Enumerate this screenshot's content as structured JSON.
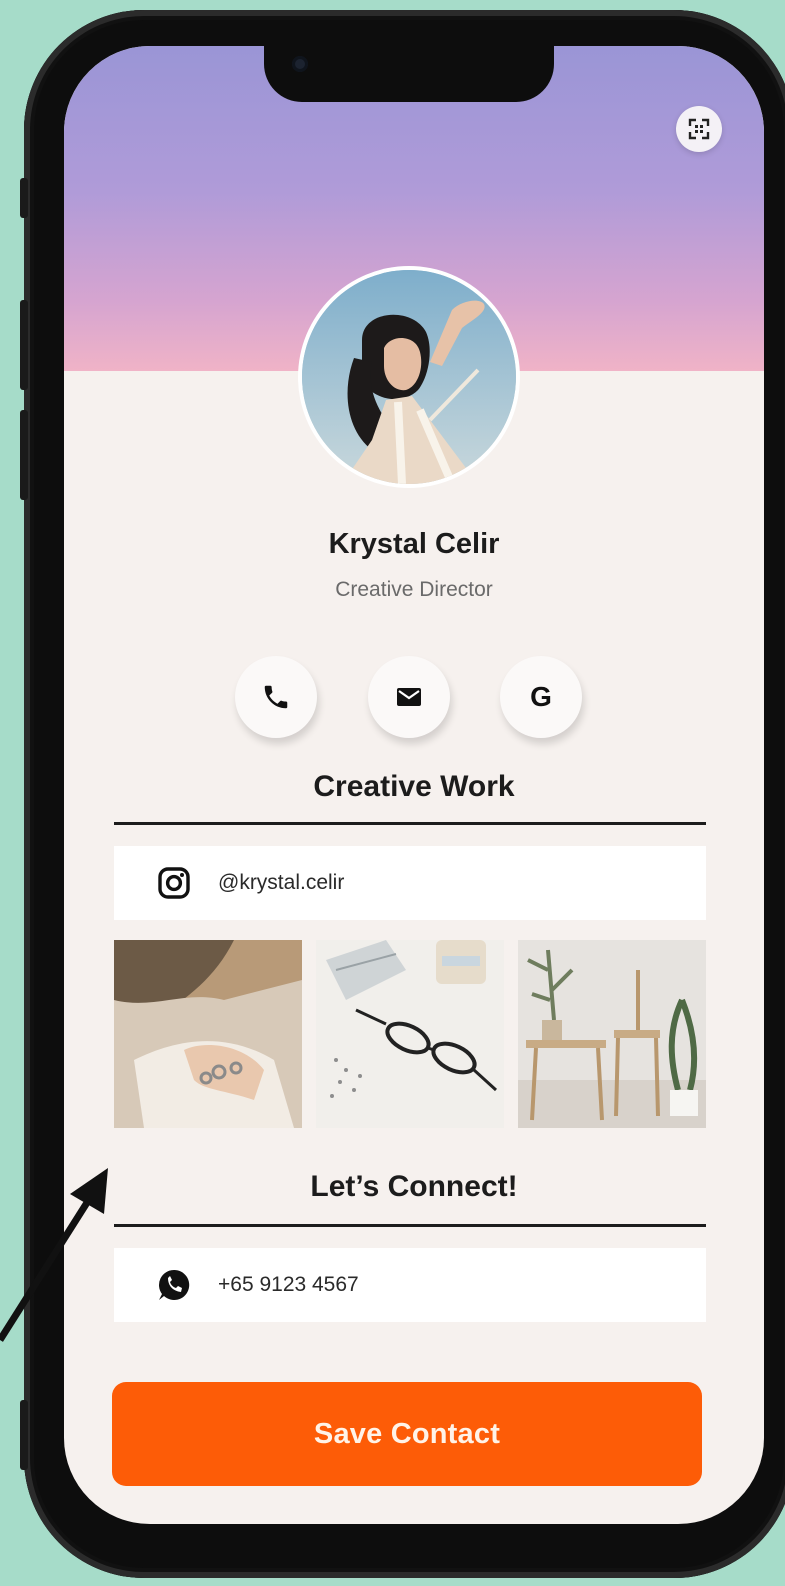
{
  "profile": {
    "name": "Krystal Celir",
    "title": "Creative Director"
  },
  "actions": {
    "icons": [
      "phone-icon",
      "mail-icon",
      "google-icon"
    ],
    "google_glyph": "G"
  },
  "creative_work": {
    "heading": "Creative Work",
    "instagram_handle": "@krystal.celir",
    "photos": [
      "hand-rings-photo",
      "glasses-desk-photo",
      "plant-chair-photo"
    ]
  },
  "connect": {
    "heading": "Let’s Connect!",
    "whatsapp_number": "+65 9123 4567"
  },
  "cta": {
    "save_label": "Save Contact"
  },
  "colors": {
    "background": "#a6dcc9",
    "accent": "#fd5c07",
    "card": "#f6f1ee"
  }
}
